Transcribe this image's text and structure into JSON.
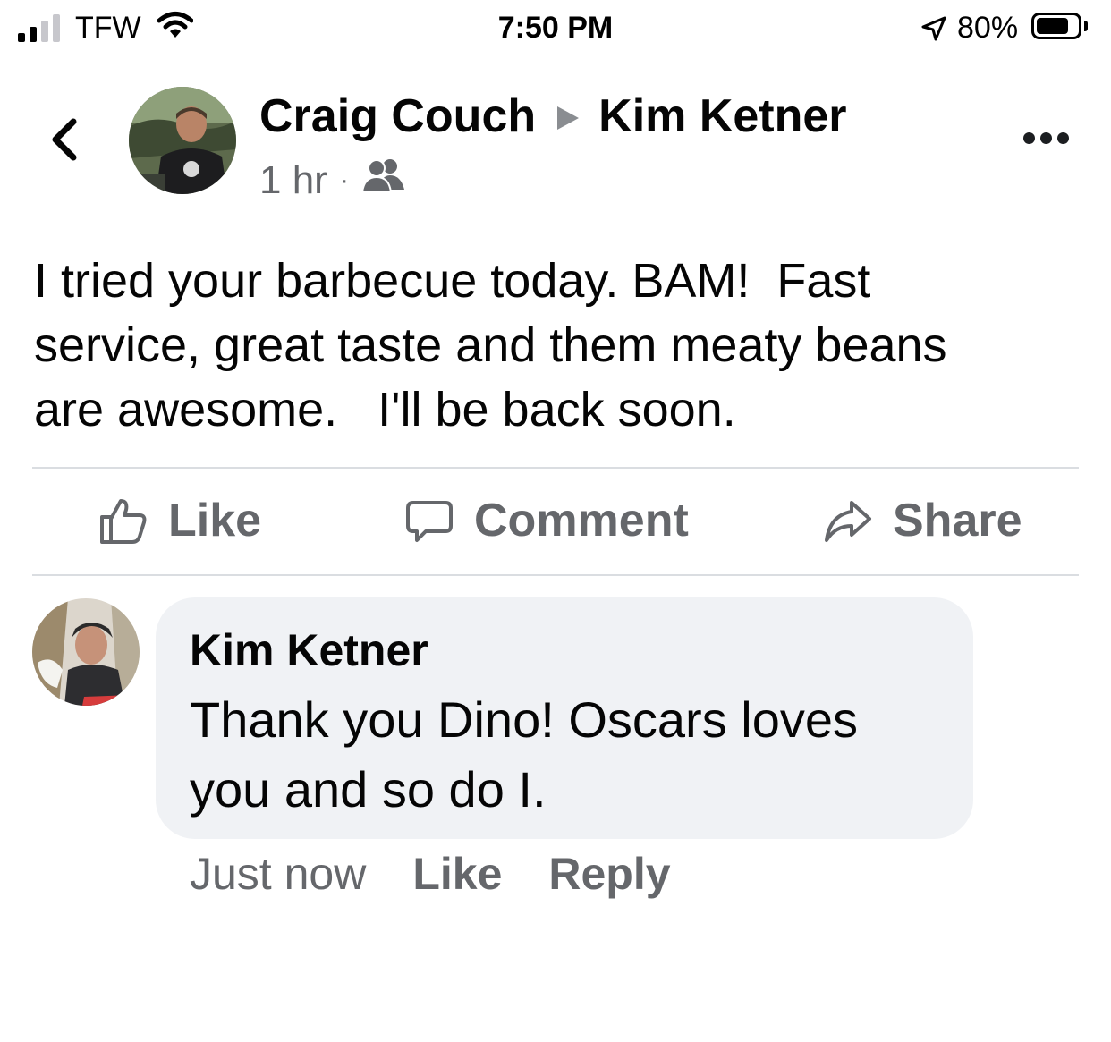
{
  "status_bar": {
    "carrier": "TFW",
    "time": "7:50 PM",
    "battery": "80%",
    "battery_level": 0.8,
    "signal_bars": 2
  },
  "post": {
    "author": "Craig Couch",
    "target": "Kim Ketner",
    "time": "1 hr",
    "dot": "·",
    "audience_icon": "friends-icon",
    "text_lines": [
      "I tried your barbecue today. BAM!  Fast",
      "service, great taste and them meaty beans",
      "are awesome.   I'll be back soon."
    ]
  },
  "actions": {
    "like": "Like",
    "comment": "Comment",
    "share": "Share"
  },
  "comment": {
    "author": "Kim Ketner",
    "text_lines": [
      "Thank you Dino! Oscars loves",
      "you and so do I."
    ],
    "time": "Just now",
    "like": "Like",
    "reply": "Reply"
  },
  "colors": {
    "secondary_text": "#65676b",
    "bubble_bg": "#f0f2f5",
    "divider": "#dadde1"
  }
}
